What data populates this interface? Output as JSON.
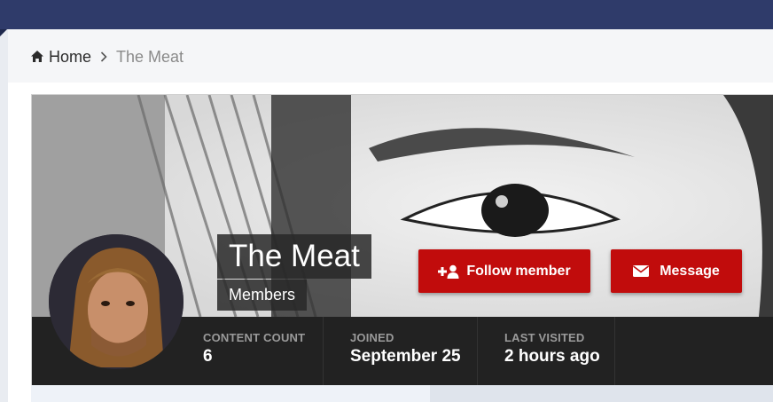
{
  "breadcrumb": {
    "home_icon": "home-icon",
    "home_label": "Home",
    "separator_icon": "chevron-right-icon",
    "current_label": "The Meat"
  },
  "profile": {
    "name": "The Meat",
    "group": "Members",
    "avatar": "profile-photo",
    "cover": "cover-photo-eye"
  },
  "actions": {
    "follow_label": "Follow member",
    "follow_icon": "add-user-icon",
    "message_label": "Message",
    "message_icon": "envelope-icon"
  },
  "stats": [
    {
      "label": "CONTENT COUNT",
      "value": "6"
    },
    {
      "label": "JOINED",
      "value": "September 25"
    },
    {
      "label": "LAST VISITED",
      "value": "2 hours ago"
    }
  ],
  "colors": {
    "topbar": "#2f3b6a",
    "button": "#c10c0c",
    "stats_bar": "#222222"
  }
}
